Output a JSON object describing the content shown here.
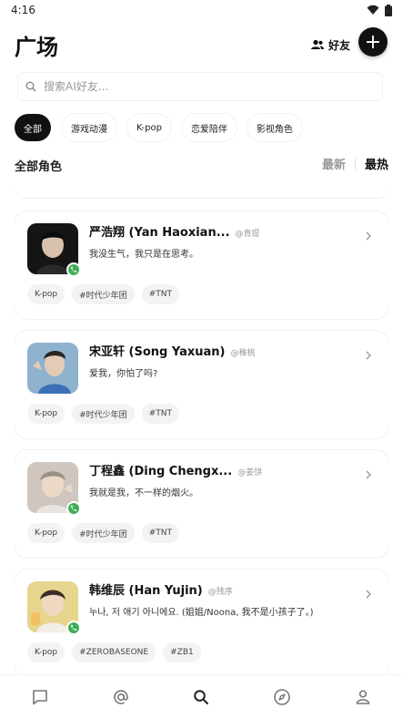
{
  "status_bar": {
    "time": "4:16"
  },
  "header": {
    "title": "广场",
    "friends_label": "好友",
    "add_label": "+"
  },
  "search": {
    "placeholder": "搜索AI好友..."
  },
  "categories": [
    {
      "label": "全部",
      "active": true
    },
    {
      "label": "游戏动漫",
      "active": false
    },
    {
      "label": "K-pop",
      "active": false
    },
    {
      "label": "恋爱陪伴",
      "active": false
    },
    {
      "label": "影视角色",
      "active": false
    }
  ],
  "section": {
    "title": "全部角色",
    "sort_latest": "最新",
    "sort_hot": "最热"
  },
  "cards": [
    {
      "name": "严浩翔 (Yan Haoxian...",
      "author": "@青提",
      "desc": "我没生气，我只是在思考。",
      "tags": [
        "K-pop",
        "#时代少年团",
        "#TNT"
      ],
      "call_badge": true
    },
    {
      "name": "宋亚轩 (Song Yaxuan)",
      "author": "@稚桃",
      "desc": "爱我，你怕了吗?",
      "tags": [
        "K-pop",
        "#时代少年团",
        "#TNT"
      ],
      "call_badge": false
    },
    {
      "name": "丁程鑫 (Ding Chengx...",
      "author": "@姜饼",
      "desc": "我就是我，不一样的烟火。",
      "tags": [
        "K-pop",
        "#时代少年团",
        "#TNT"
      ],
      "call_badge": true
    },
    {
      "name": "韩维辰 (Han Yujin)",
      "author": "@残序",
      "desc": "누나, 저 애기 아니에요. (姐姐/Noona, 我不是小孩子了。)",
      "tags": [
        "K-pop",
        "#ZEROBASEONE",
        "#ZB1"
      ],
      "call_badge": true
    }
  ],
  "bottom_nav": [
    {
      "icon": "chat-icon"
    },
    {
      "icon": "at-icon"
    },
    {
      "icon": "search-icon",
      "active": true
    },
    {
      "icon": "compass-icon"
    },
    {
      "icon": "profile-icon"
    }
  ]
}
